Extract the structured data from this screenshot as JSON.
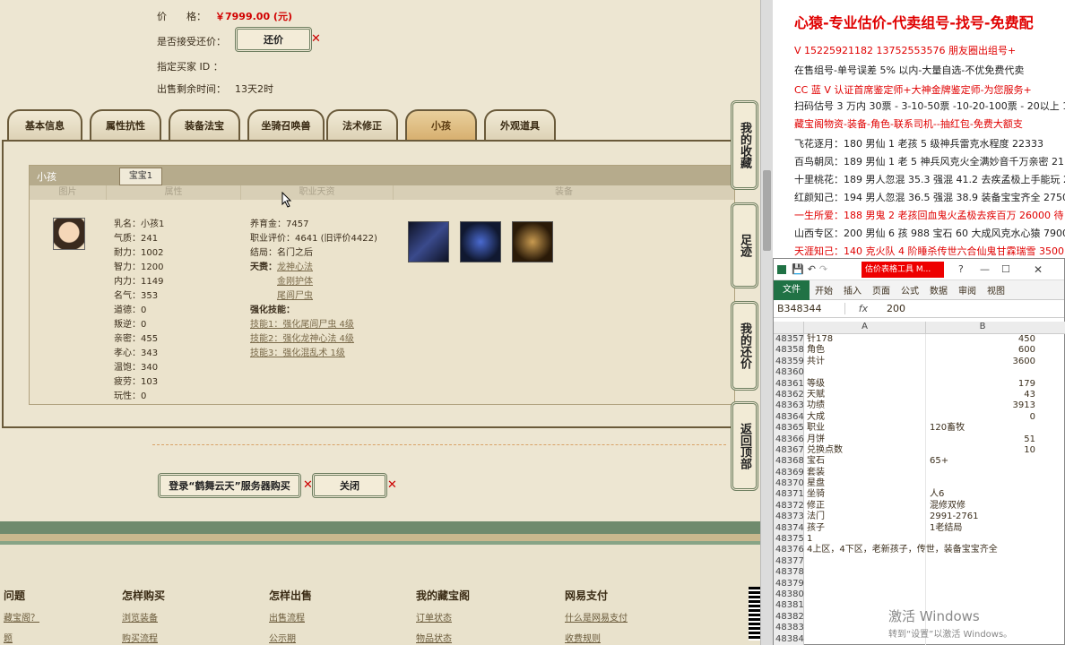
{
  "sale": {
    "price_label": "价　　格：",
    "price_value": "￥7999.00 (元)",
    "counter_label": "是否接受还价：",
    "counter_button": "还价",
    "buyer_label": "指定买家 ID ：",
    "remaining_label": "出售剩余时间：",
    "remaining_value": "13天2时"
  },
  "tabs": [
    "基本信息",
    "属性抗性",
    "装备法宝",
    "坐骑召唤兽",
    "法术修正",
    "小孩",
    "外观道具"
  ],
  "active_tab": "小孩",
  "panel": {
    "title": "小孩",
    "subtab": "宝宝1",
    "columns": [
      "图片",
      "属性",
      "职业天资",
      "装备"
    ],
    "stats": [
      "乳名：小孩1",
      "气质：241",
      "耐力：1002",
      "智力：1200",
      "内力：1149",
      "名气：353",
      "道德：0",
      "叛逆：0",
      "亲密：455",
      "孝心：343",
      "温饱：340",
      "疲劳：103",
      "玩性：0"
    ],
    "career": [
      "养育金：7457",
      "职业评价：4641 (旧评价4422)",
      "结局：名门之后"
    ],
    "talent_label": "天赉：",
    "talents": [
      "龙神心法",
      "金刚护体",
      "尾闾尸虫"
    ],
    "skills_label": "强化技能：",
    "skills": [
      "技能1：强化尾闾尸虫 4级",
      "技能2：强化龙神心法 4级",
      "技能3：强化混乱术 1级"
    ]
  },
  "side_tabs": [
    "我的收藏",
    "足迹",
    "我的还价",
    "返回顶部"
  ],
  "buttons": {
    "login": "登录“鹤舞云天”服务器购买",
    "close": "关闭"
  },
  "footer": [
    {
      "title": "问题",
      "links": [
        "藏宝阁？",
        "题"
      ]
    },
    {
      "title": "怎样购买",
      "links": [
        "浏览装备",
        "购买流程"
      ]
    },
    {
      "title": "怎样出售",
      "links": [
        "出售流程",
        "公示期"
      ]
    },
    {
      "title": "我的藏宝阁",
      "links": [
        "订单状态",
        "物品状态"
      ]
    },
    {
      "title": "网易支付",
      "links": [
        "什么是网易支付",
        "收费规则"
      ]
    }
  ],
  "ad": {
    "headline": "心猿-专业估价-代卖组号-找号-免费配",
    "lines": [
      {
        "text": "V 15225921182  13752553576 朋友圈出组号+",
        "red": true
      },
      {
        "text": "在售组号-单号误差 5% 以内-大量自选-不优免费代卖",
        "red": false
      },
      {
        "text": "CC 蓝 V 认证首席鉴定师+大神金牌鉴定师-为您服务+",
        "red": true
      },
      {
        "text": "扫码估号 3 万内 30票 - 3-10-50票  -10-20-100票 - 20以上 15",
        "red": false
      },
      {
        "text": "藏宝阁物资-装备-角色-联系司机--抽红包-免费大额支",
        "red": true
      },
      {
        "text": "飞花逐月：180 男仙 1 老孩 5 级神兵雷克水程度 22333",
        "red": false
      },
      {
        "text": "百鸟朝凤：189 男仙 1 老 5 神兵风克火全满妙音千万亲密 21",
        "red": false
      },
      {
        "text": "十里桃花：189 男人忽混 35.3 强混 41.2 去疾孟极上手能玩 2",
        "red": false
      },
      {
        "text": "红颜知己：194 男人忽混 36.5 强混 38.9 装备宝宝齐全 27500",
        "red": false
      },
      {
        "text": "一生所爱：188 男鬼 2 老孩回血鬼火孟极去疾百万 26000 待",
        "red": true
      },
      {
        "text": "山西专区：200 男仙 6 孩 988 宝石 60 大成风克水心猿 79000",
        "red": false
      },
      {
        "text": "天涯知己：140 克火队 4 阶睡杀传世六合仙鬼甘霖瑞雪 3500",
        "red": true
      }
    ]
  },
  "excel": {
    "title_badge": "估价表格工具 M...",
    "ribbon": [
      "文件",
      "开始",
      "插入",
      "页面",
      "公式",
      "数据",
      "审阅",
      "视图"
    ],
    "cellref": "B348344",
    "fx": "fx",
    "formula": "200",
    "col_a": "A",
    "col_b": "B",
    "rows": [
      {
        "n": "48357",
        "a": "针178",
        "b": "450"
      },
      {
        "n": "48358",
        "a": "角色",
        "b": "600"
      },
      {
        "n": "48359",
        "a": "共计",
        "b": "3600"
      },
      {
        "n": "48360",
        "a": "",
        "b": ""
      },
      {
        "n": "48361",
        "a": "等级",
        "b": "179"
      },
      {
        "n": "48362",
        "a": "天赋",
        "b": "43"
      },
      {
        "n": "48363",
        "a": "功绩",
        "b": "3913"
      },
      {
        "n": "48364",
        "a": "大成",
        "b": "0"
      },
      {
        "n": "48365",
        "a": "职业",
        "b": "120畜牧",
        "bl": true
      },
      {
        "n": "48366",
        "a": "月饼",
        "b": "51"
      },
      {
        "n": "48367",
        "a": "兑换点数",
        "b": "10"
      },
      {
        "n": "48368",
        "a": "宝石",
        "b": "65+",
        "bl": true
      },
      {
        "n": "48369",
        "a": "套装",
        "b": ""
      },
      {
        "n": "48370",
        "a": "星盘",
        "b": ""
      },
      {
        "n": "48371",
        "a": "坐骑",
        "b": "人6",
        "bl": true
      },
      {
        "n": "48372",
        "a": "修正",
        "b": "混修双修",
        "bl": true
      },
      {
        "n": "48373",
        "a": "法门",
        "b": "2991-2761",
        "bl": true
      },
      {
        "n": "48374",
        "a": "孩子",
        "b": "1老结局",
        "bl": true
      },
      {
        "n": "48375",
        "a": "                    1",
        "b": ""
      },
      {
        "n": "48376",
        "a": "4上区，4下区，老新孩子，传世，装备宝宝齐全",
        "b": ""
      },
      {
        "n": "48377",
        "a": "",
        "b": ""
      },
      {
        "n": "48378",
        "a": "",
        "b": ""
      },
      {
        "n": "48379",
        "a": "",
        "b": ""
      },
      {
        "n": "48380",
        "a": "",
        "b": ""
      },
      {
        "n": "48381",
        "a": "",
        "b": ""
      },
      {
        "n": "48382",
        "a": "",
        "b": ""
      },
      {
        "n": "48383",
        "a": "",
        "b": ""
      },
      {
        "n": "48384",
        "a": "",
        "b": ""
      }
    ]
  },
  "watermark": {
    "line1": "激活 Windows",
    "line2": "转到“设置”以激活 Windows。"
  }
}
